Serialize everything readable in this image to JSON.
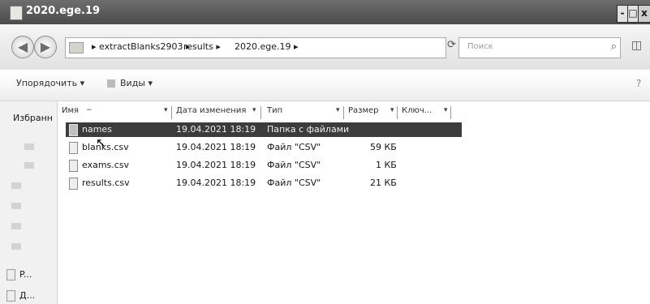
{
  "window": {
    "title": "2020.ege.19",
    "min": "-",
    "max": "□",
    "close": "x"
  },
  "address": {
    "crumbs": [
      "▸ extractBlanks2903 ▸",
      "results ▸",
      "2020.ege.19 ▸"
    ],
    "dropdown": "▾",
    "refresh": "⟳",
    "search_placeholder": "Поиск",
    "search_icon": "⌕",
    "extra_icon": "◫"
  },
  "toolbar": {
    "organize": "Упорядочить ▾",
    "views": "Виды ▾",
    "help": "?"
  },
  "nav": {
    "favorites": "Избранн",
    "items": [
      {
        "label": "P..."
      },
      {
        "label": "Д..."
      }
    ]
  },
  "columns": [
    "Имя",
    "Дата изменения",
    "Тип",
    "Размер",
    "Ключ..."
  ],
  "files": [
    {
      "name": "names",
      "date": "19.04.2021 18:19",
      "type": "Папка с файлами",
      "size": "",
      "selected": true
    },
    {
      "name": "blanks.csv",
      "date": "19.04.2021 18:19",
      "type": "Файл \"CSV\"",
      "size": "59 КБ"
    },
    {
      "name": "exams.csv",
      "date": "19.04.2021 18:19",
      "type": "Файл \"CSV\"",
      "size": "1 КБ"
    },
    {
      "name": "results.csv",
      "date": "19.04.2021 18:19",
      "type": "Файл \"CSV\"",
      "size": "21 КБ"
    }
  ]
}
